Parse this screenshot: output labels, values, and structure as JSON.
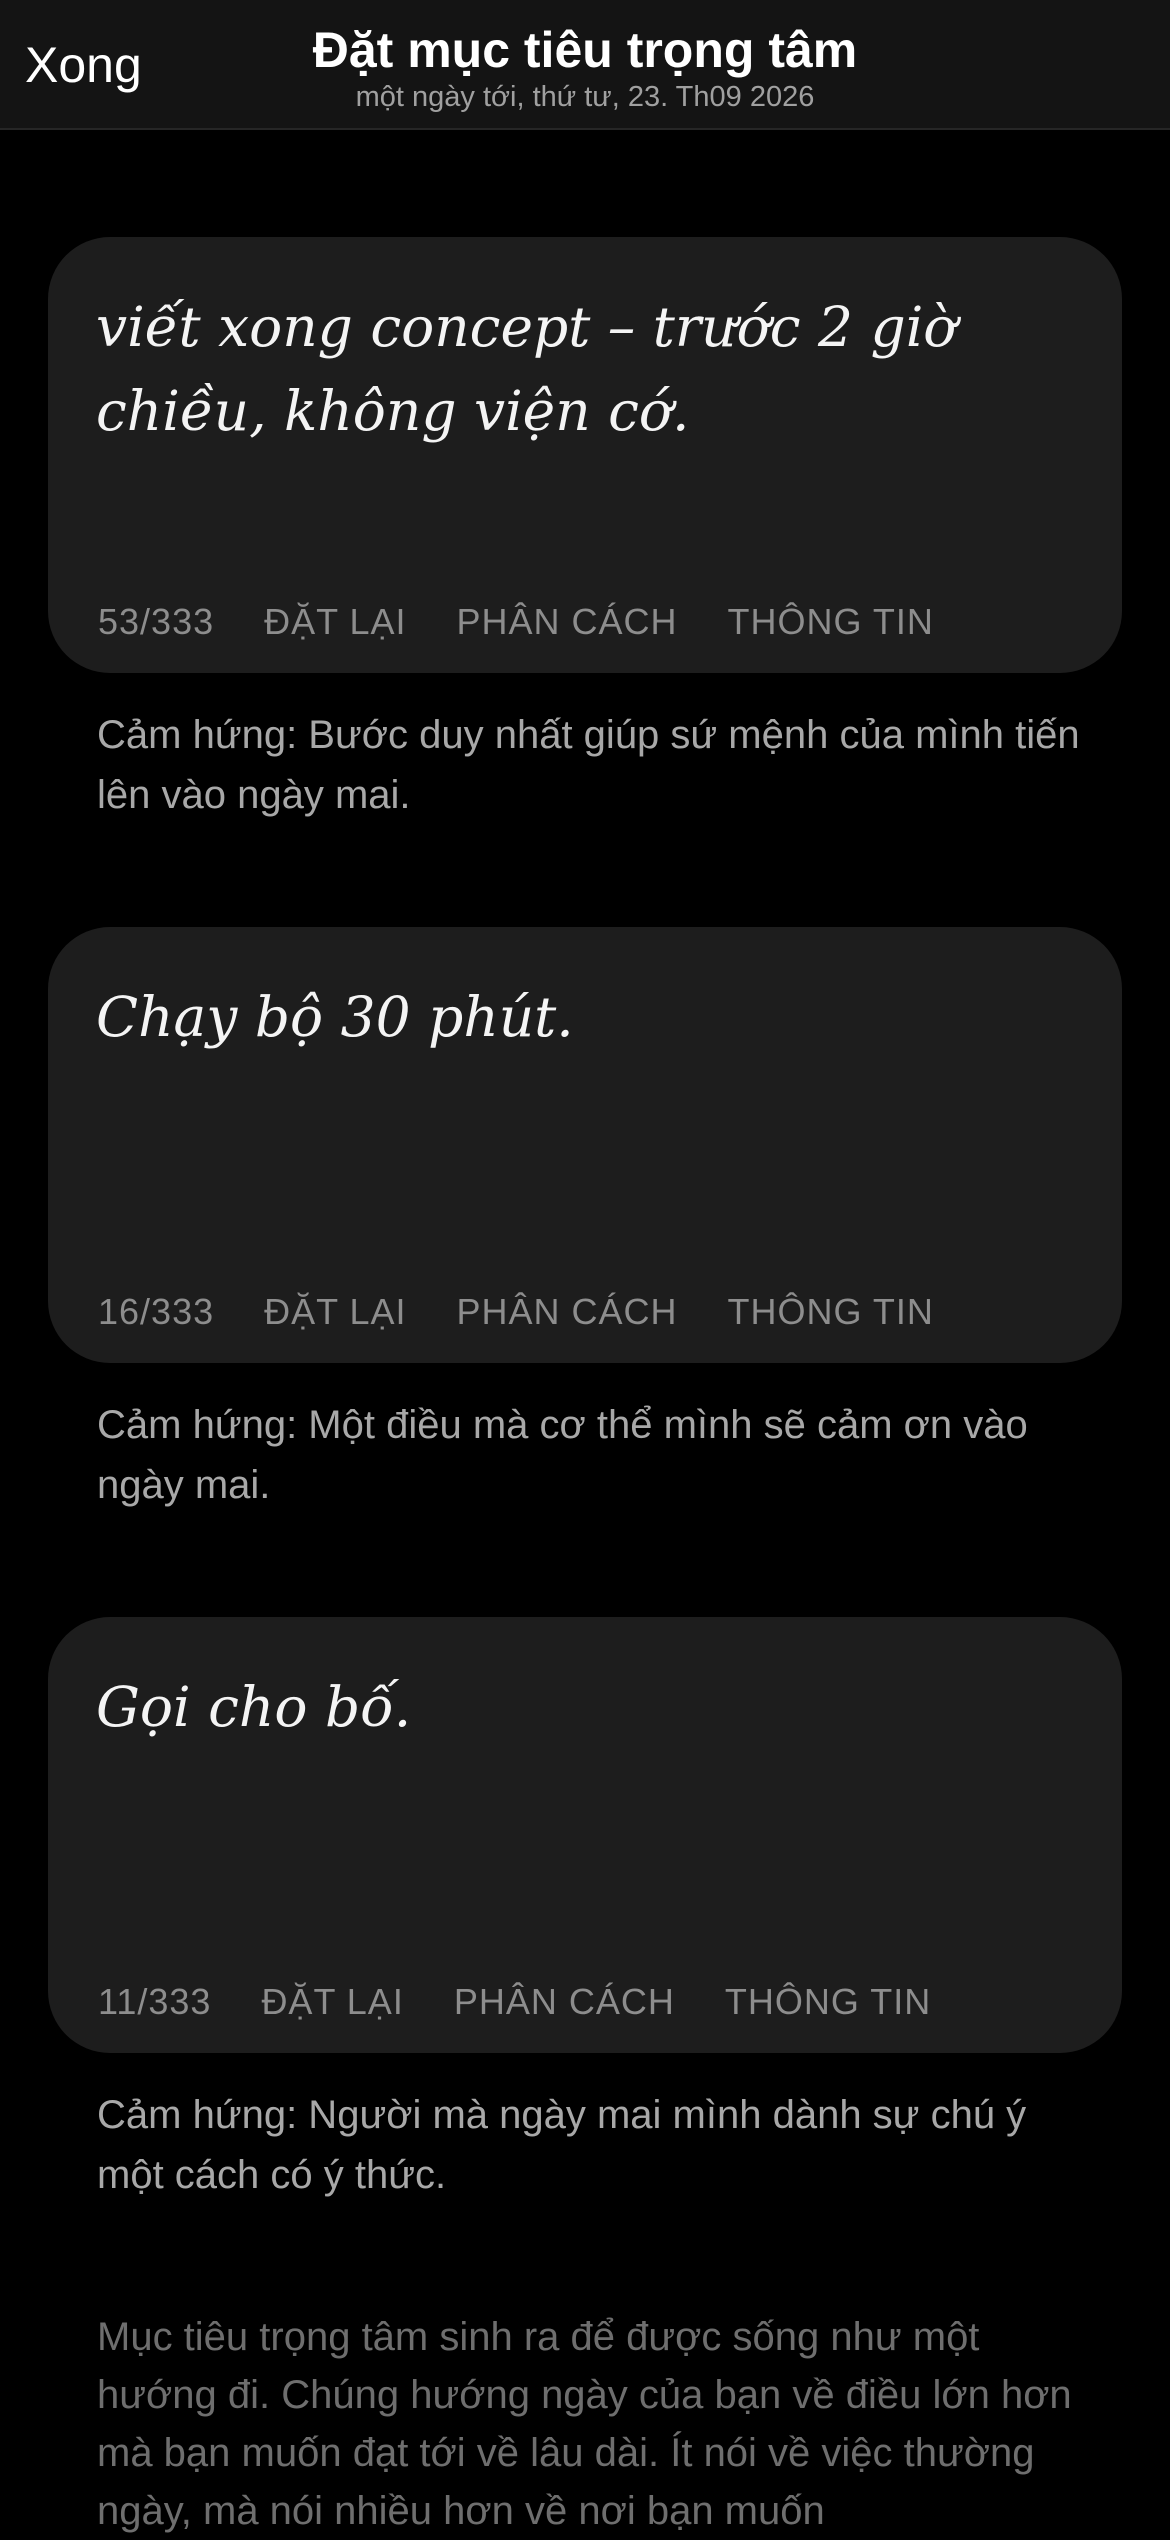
{
  "header": {
    "done_label": "Xong",
    "title": "Đặt mục tiêu trọng tâm",
    "subtitle": "một ngày tới, thứ tư, 23. Th09 2026"
  },
  "cards": [
    {
      "goal": "viết xong concept – trước 2 giờ chiều, không viện cớ.",
      "count": "53/333",
      "reset": "ĐẶT LẠI",
      "separator": "PHÂN CÁCH",
      "info": "THÔNG TIN",
      "inspiration": "Cảm hứng: Bước duy nhất giúp sứ mệnh của mình tiến lên vào ngày mai."
    },
    {
      "goal": "Chạy bộ 30 phút.",
      "count": "16/333",
      "reset": "ĐẶT LẠI",
      "separator": "PHÂN CÁCH",
      "info": "THÔNG TIN",
      "inspiration": "Cảm hứng: Một điều mà cơ thể mình sẽ cảm ơn vào ngày mai."
    },
    {
      "goal": "Gọi cho bố.",
      "count": "11/333",
      "reset": "ĐẶT LẠI",
      "separator": "PHÂN CÁCH",
      "info": "THÔNG TIN",
      "inspiration": "Cảm hứng: Người mà ngày mai mình dành sự chú ý một cách có ý thức."
    }
  ],
  "footer_note": "Mục tiêu trọng tâm sinh ra để được sống như một hướng đi. Chúng hướng ngày của bạn về điều lớn hơn mà bạn muốn đạt tới về lâu dài. Ít nói về việc thường ngày, mà nói nhiều hơn về nơi bạn muốn",
  "colors": {
    "background": "#000000",
    "card": "#1d1d1d",
    "header": "#141414",
    "muted_text": "#8d8d8d"
  }
}
